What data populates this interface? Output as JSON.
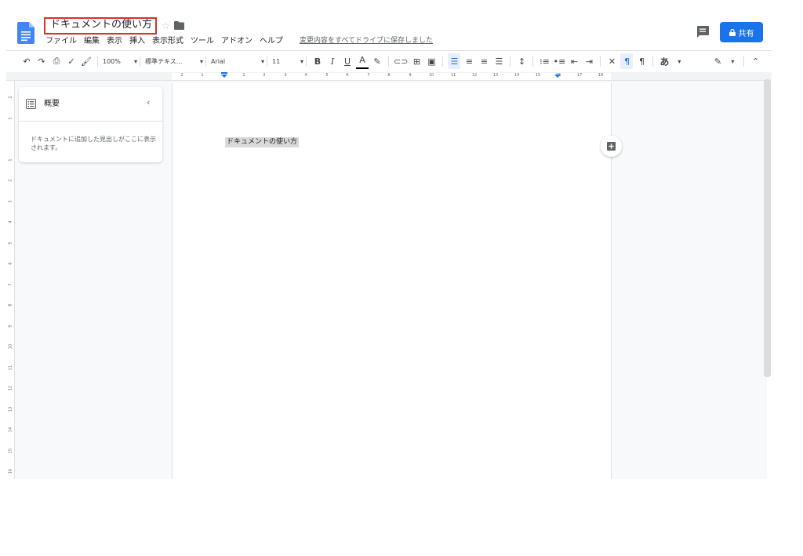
{
  "header": {
    "doc_title": "ドキュメントの使い方",
    "save_status": "変更内容をすべてドライブに保存しました",
    "share_label": "共有"
  },
  "menu": {
    "items": [
      "ファイル",
      "編集",
      "表示",
      "挿入",
      "表示形式",
      "ツール",
      "アドオン",
      "ヘルプ"
    ]
  },
  "toolbar": {
    "zoom": "100%",
    "style": "標準テキス...",
    "font": "Arial",
    "size": "11",
    "bold": "B",
    "italic": "I",
    "underline": "U",
    "text_color": "A",
    "input_tools": "あ"
  },
  "ruler": {
    "horizontal": [
      "2",
      "1",
      "1",
      "2",
      "3",
      "4",
      "5",
      "6",
      "7",
      "8",
      "9",
      "10",
      "11",
      "12",
      "13",
      "14",
      "15",
      "16",
      "17",
      "18"
    ],
    "vertical": [
      "2",
      "1",
      "1",
      "2",
      "3",
      "4",
      "5",
      "6",
      "7",
      "8",
      "9",
      "10",
      "11",
      "12",
      "13",
      "14",
      "15",
      "16"
    ]
  },
  "outline": {
    "title": "概要",
    "empty_text": "ドキュメントに追加した見出しがここに表示されます。"
  },
  "document": {
    "heading": "ドキュメントの使い方"
  },
  "colors": {
    "accent": "#1a73e8",
    "title_highlight": "#d93025",
    "selection": "#d9d9d9"
  }
}
